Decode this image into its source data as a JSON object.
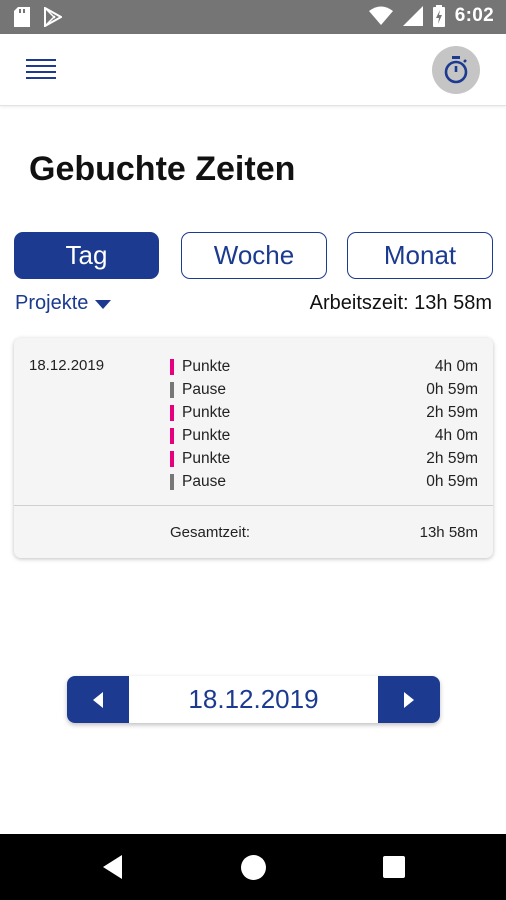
{
  "statusbar": {
    "time": "6:02",
    "icons": [
      "sd-card-icon",
      "play-store-icon",
      "wifi-icon",
      "signal-icon",
      "battery-charging-icon"
    ]
  },
  "appbar": {
    "menu_icon": "menu-icon",
    "timer_icon": "stopwatch-icon"
  },
  "page": {
    "title": "Gebuchte Zeiten"
  },
  "tabs": [
    {
      "label": "Tag",
      "active": true
    },
    {
      "label": "Woche",
      "active": false
    },
    {
      "label": "Monat",
      "active": false
    }
  ],
  "filter": {
    "projects_label": "Projekte",
    "work_time": "Arbeitszeit: 13h 58m"
  },
  "card": {
    "date": "18.12.2019",
    "entries": [
      {
        "label": "Punkte",
        "duration": "4h 0m",
        "color": "#e6007e"
      },
      {
        "label": "Pause",
        "duration": "0h 59m",
        "color": "#777777"
      },
      {
        "label": "Punkte",
        "duration": "2h 59m",
        "color": "#e6007e"
      },
      {
        "label": "Punkte",
        "duration": "4h 0m",
        "color": "#e6007e"
      },
      {
        "label": "Punkte",
        "duration": "2h 59m",
        "color": "#e6007e"
      },
      {
        "label": "Pause",
        "duration": "0h 59m",
        "color": "#777777"
      }
    ],
    "total_label": "Gesamtzeit:",
    "total_value": "13h 58m"
  },
  "datenav": {
    "date": "18.12.2019",
    "prev_icon": "arrow-left-icon",
    "next_icon": "arrow-right-icon"
  },
  "colors": {
    "primary": "#1c3a8f",
    "punkte": "#e6007e",
    "pause": "#777777"
  }
}
